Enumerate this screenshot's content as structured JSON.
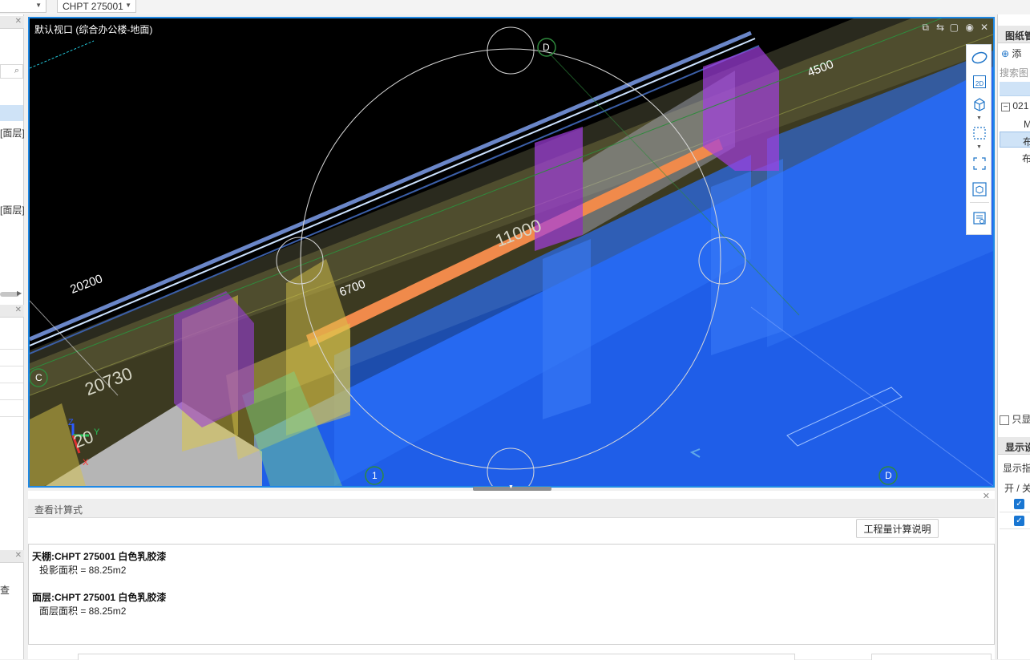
{
  "toolbar": {
    "combo1_value": "",
    "combo2_value": "CHPT 275001"
  },
  "left_panel": {
    "items": [
      "[面层]",
      "[面层]",
      "查"
    ]
  },
  "viewport": {
    "title": "默认视口 (综合办公楼-地面)",
    "labels": {
      "dim_20200": "20200",
      "dim_20730": "20730",
      "dim_6700": "6700",
      "dim_11000": "11000",
      "dim_4500": "4500",
      "dim_20x": "20",
      "axis_d_top": "D",
      "axis_c": "C",
      "axis_1": "1",
      "axis_d_bottom": "D",
      "gizmo_x": "X",
      "gizmo_y": "Y",
      "gizmo_z": "Z"
    },
    "tools": [
      "orbit-icon",
      "2d-view-icon",
      "3d-box-icon",
      "selection-box-icon",
      "fullscreen-icon",
      "cube-view-icon",
      "properties-icon"
    ],
    "tool_2d_label": "2D",
    "colors": {
      "background": "#000000",
      "floor_blue": "#1f5ee8",
      "wall_yellow": "#d8c44a",
      "column_purple": "#a23ee0",
      "beam_orange": "#f08a4b",
      "frame_border": "#1e88e5"
    }
  },
  "formula_panel": {
    "title": "查看计算式",
    "calc_button": "工程量计算说明",
    "entries": [
      {
        "title": "天棚:CHPT 275001 白色乳胶漆",
        "line": "投影面积 = 88.25m2"
      },
      {
        "title": "面层:CHPT 275001 白色乳胶漆",
        "line": "面层面积 = 88.25m2"
      }
    ]
  },
  "right_panel": {
    "header": "图纸管",
    "add_label": "添",
    "search_placeholder": "搜索图",
    "tree": [
      "021",
      "M",
      "布",
      "布"
    ],
    "only_show": "只显",
    "display_header": "显示设",
    "display_label": "显示指",
    "toggle_header": "开 / 关"
  }
}
